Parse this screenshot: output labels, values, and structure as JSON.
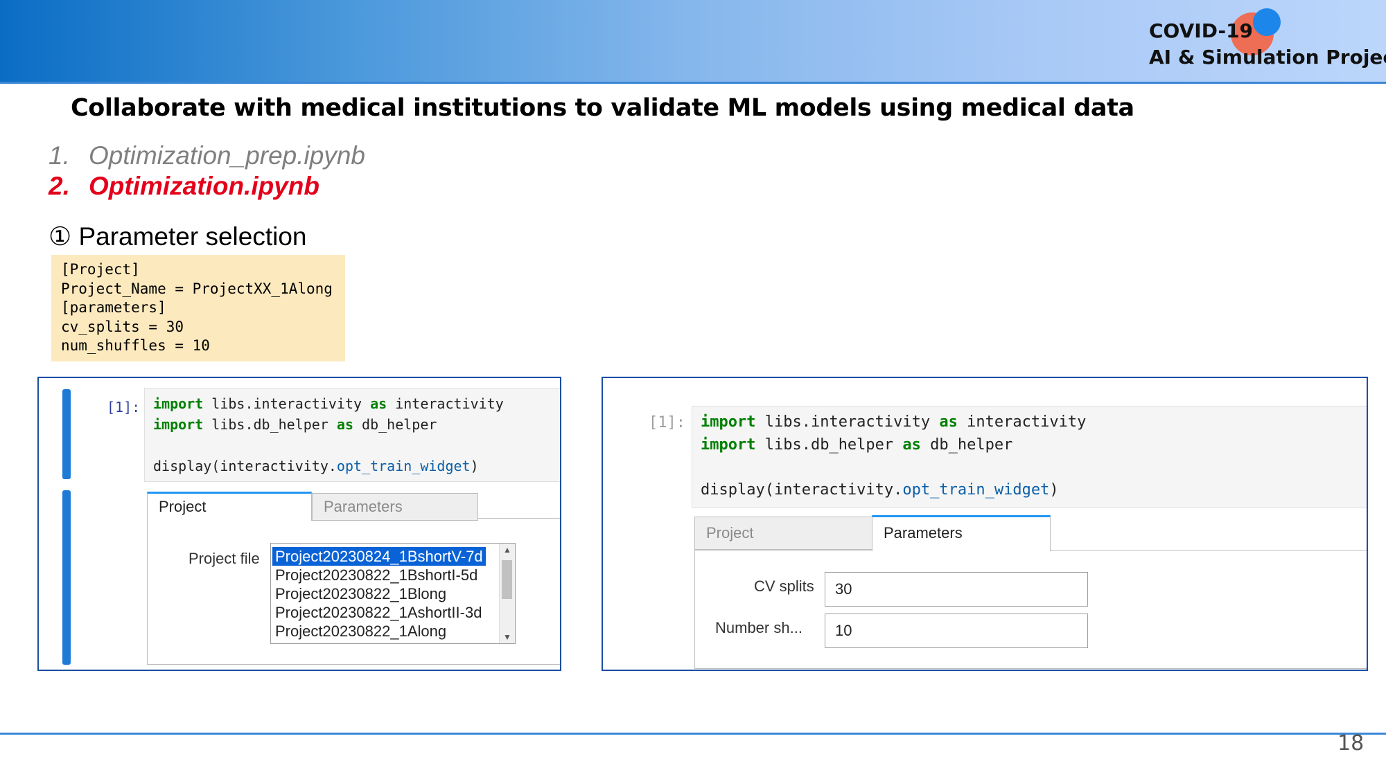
{
  "header": {
    "brand_line1": "COVID-19",
    "brand_line2": "AI & Simulation Project",
    "accent_color": "#3b86d6"
  },
  "slide_title": "Collaborate with medical institutions to validate ML models using medical data",
  "steps": [
    {
      "number": "1.",
      "name": "Optimization_prep.ipynb",
      "color": "#7f7f7f"
    },
    {
      "number": "2.",
      "name": "Optimization.ipynb",
      "color": "#e3001a"
    }
  ],
  "section_heading": "① Parameter selection",
  "config": {
    "lines": [
      "[Project]",
      "Project_Name = ProjectXX_1Along",
      "[parameters]",
      "cv_splits = 30",
      "num_shuffles = 10"
    ]
  },
  "notebook_left": {
    "prompt": "[1]:",
    "code": {
      "kw_import": "import",
      "kw_as": "as",
      "mod1": " libs.interactivity ",
      "alias1": " interactivity",
      "mod2": " libs.db_helper ",
      "alias2": " db_helper",
      "call_prefix": "display(interactivity.",
      "call_attr": "opt_train_widget",
      "call_suffix": ")"
    },
    "tabs": [
      {
        "label": "Project",
        "active": true
      },
      {
        "label": "Parameters",
        "active": false
      }
    ],
    "project_file_label": "Project file",
    "project_files": [
      "Project20230824_1BshortV-7d",
      "Project20230822_1BshortI-5d",
      "Project20230822_1Blong",
      "Project20230822_1AshortII-3d",
      "Project20230822_1Along"
    ],
    "selected_index": 0
  },
  "notebook_right": {
    "prompt": "[1]:",
    "code": {
      "kw_import": "import",
      "kw_as": "as",
      "mod1": " libs.interactivity ",
      "alias1": " interactivity",
      "mod2": " libs.db_helper ",
      "alias2": " db_helper",
      "call_prefix": "display(interactivity.",
      "call_attr": "opt_train_widget",
      "call_suffix": ")"
    },
    "tabs": [
      {
        "label": "Project",
        "active": false
      },
      {
        "label": "Parameters",
        "active": true
      }
    ],
    "cv_splits_label": "CV splits",
    "cv_splits_value": "30",
    "num_shuffles_label": "Number sh...",
    "num_shuffles_value": "10"
  },
  "page_number": "18"
}
